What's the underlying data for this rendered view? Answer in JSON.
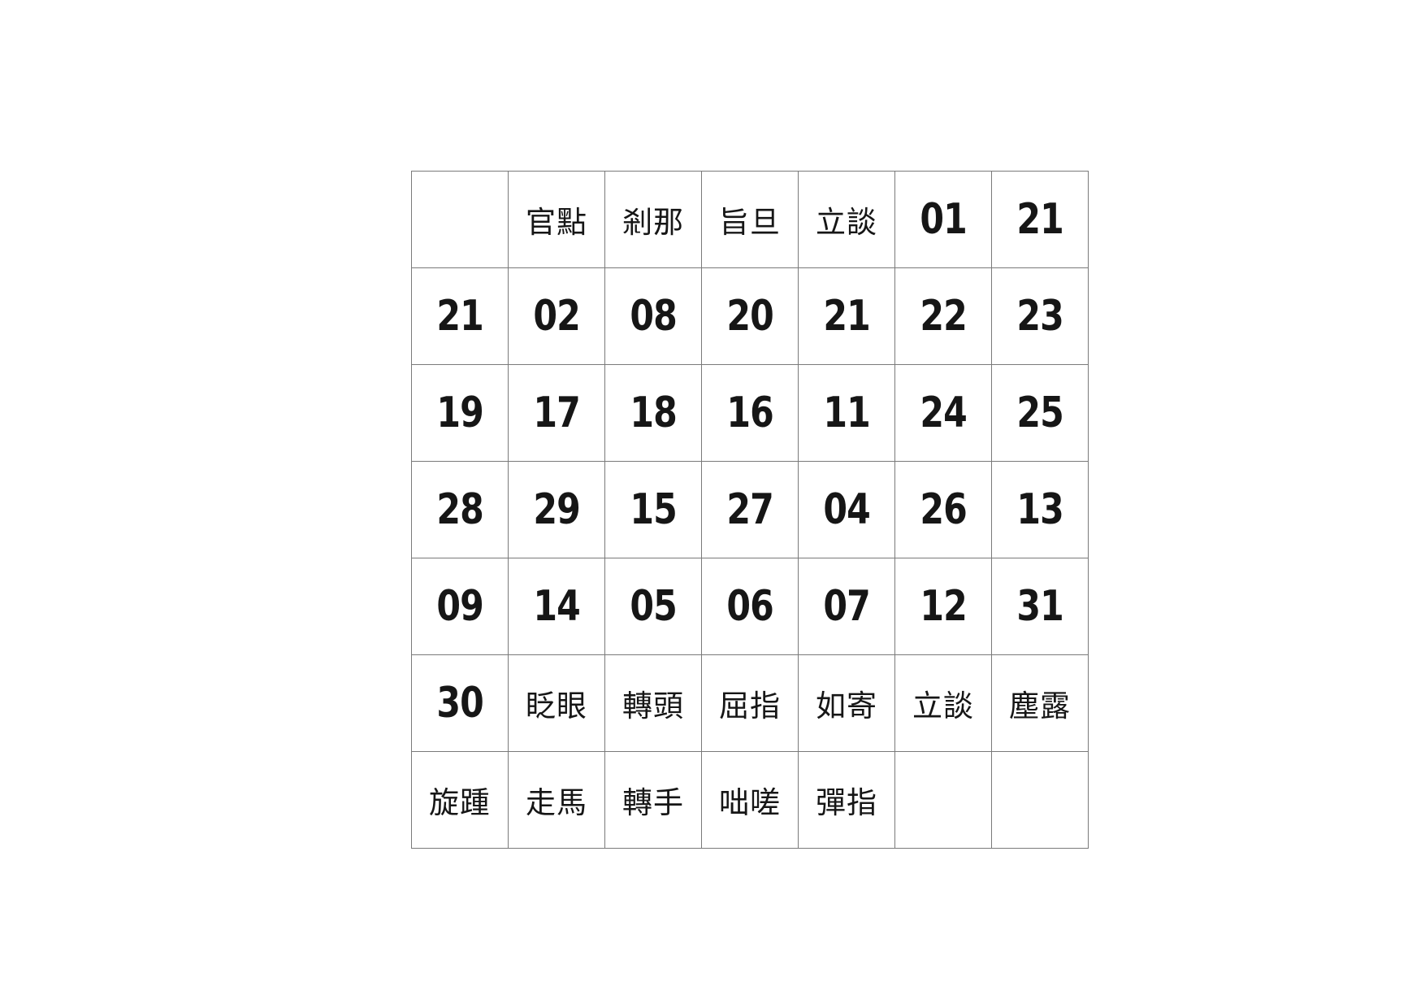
{
  "grid": {
    "cells": [
      "",
      "官點",
      "剎那",
      "旨旦",
      "立談",
      "01",
      "21",
      "21",
      "02",
      "08",
      "20",
      "21",
      "22",
      "23",
      "19",
      "17",
      "18",
      "16",
      "11",
      "24",
      "25",
      "28",
      "29",
      "15",
      "27",
      "04",
      "26",
      "13",
      "09",
      "14",
      "05",
      "06",
      "07",
      "12",
      "31",
      "30",
      "眨眼",
      "轉頭",
      "屈指",
      "如寄",
      "立談",
      "塵露",
      "旋踵",
      "走馬",
      "轉手",
      "咄嗟",
      "彈指",
      "",
      ""
    ]
  }
}
